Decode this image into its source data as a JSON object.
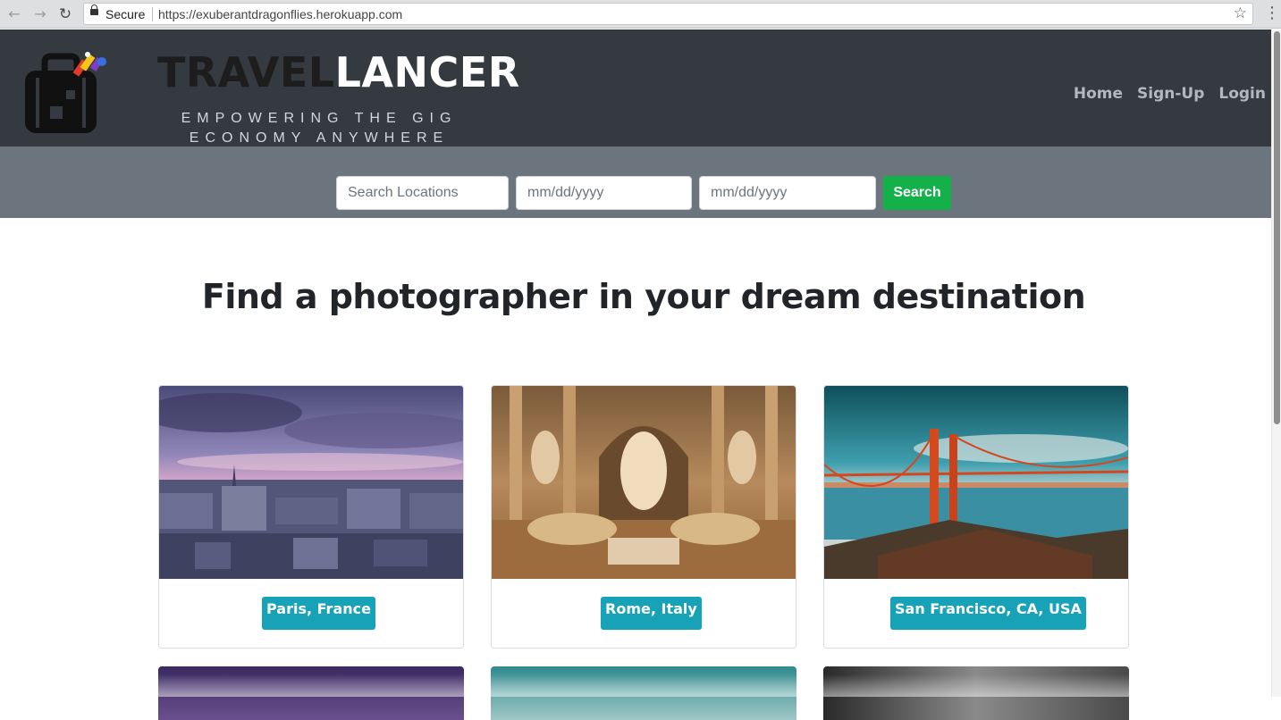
{
  "browser": {
    "secure_label": "Secure",
    "url": "https://exuberantdragonflies.herokuapp.com",
    "back_icon": "←",
    "forward_icon": "→",
    "reload_icon": "↻",
    "bookmark_icon": "☆",
    "menu_icon": "⋮"
  },
  "header": {
    "brand_dark": "TRAVEL",
    "brand_light": "LANCER",
    "tagline": "EMPOWERING THE GIG ECONOMY ANYWHERE",
    "nav": {
      "home": "Home",
      "signup": "Sign-Up",
      "login": "Login"
    }
  },
  "search": {
    "location_placeholder": "Search Locations",
    "start_date_placeholder": "mm/dd/yyyy",
    "end_date_placeholder": "mm/dd/yyyy",
    "button_label": "Search"
  },
  "main": {
    "headline": "Find a photographer in your dream destination",
    "destinations": [
      {
        "label": "Paris, France"
      },
      {
        "label": "Rome, Italy"
      },
      {
        "label": "San Francisco, CA, USA"
      }
    ]
  },
  "colors": {
    "header_bg": "#343a40",
    "search_bg": "#6c757d",
    "search_button": "#14b14a",
    "label_bg": "#17a2b8"
  }
}
